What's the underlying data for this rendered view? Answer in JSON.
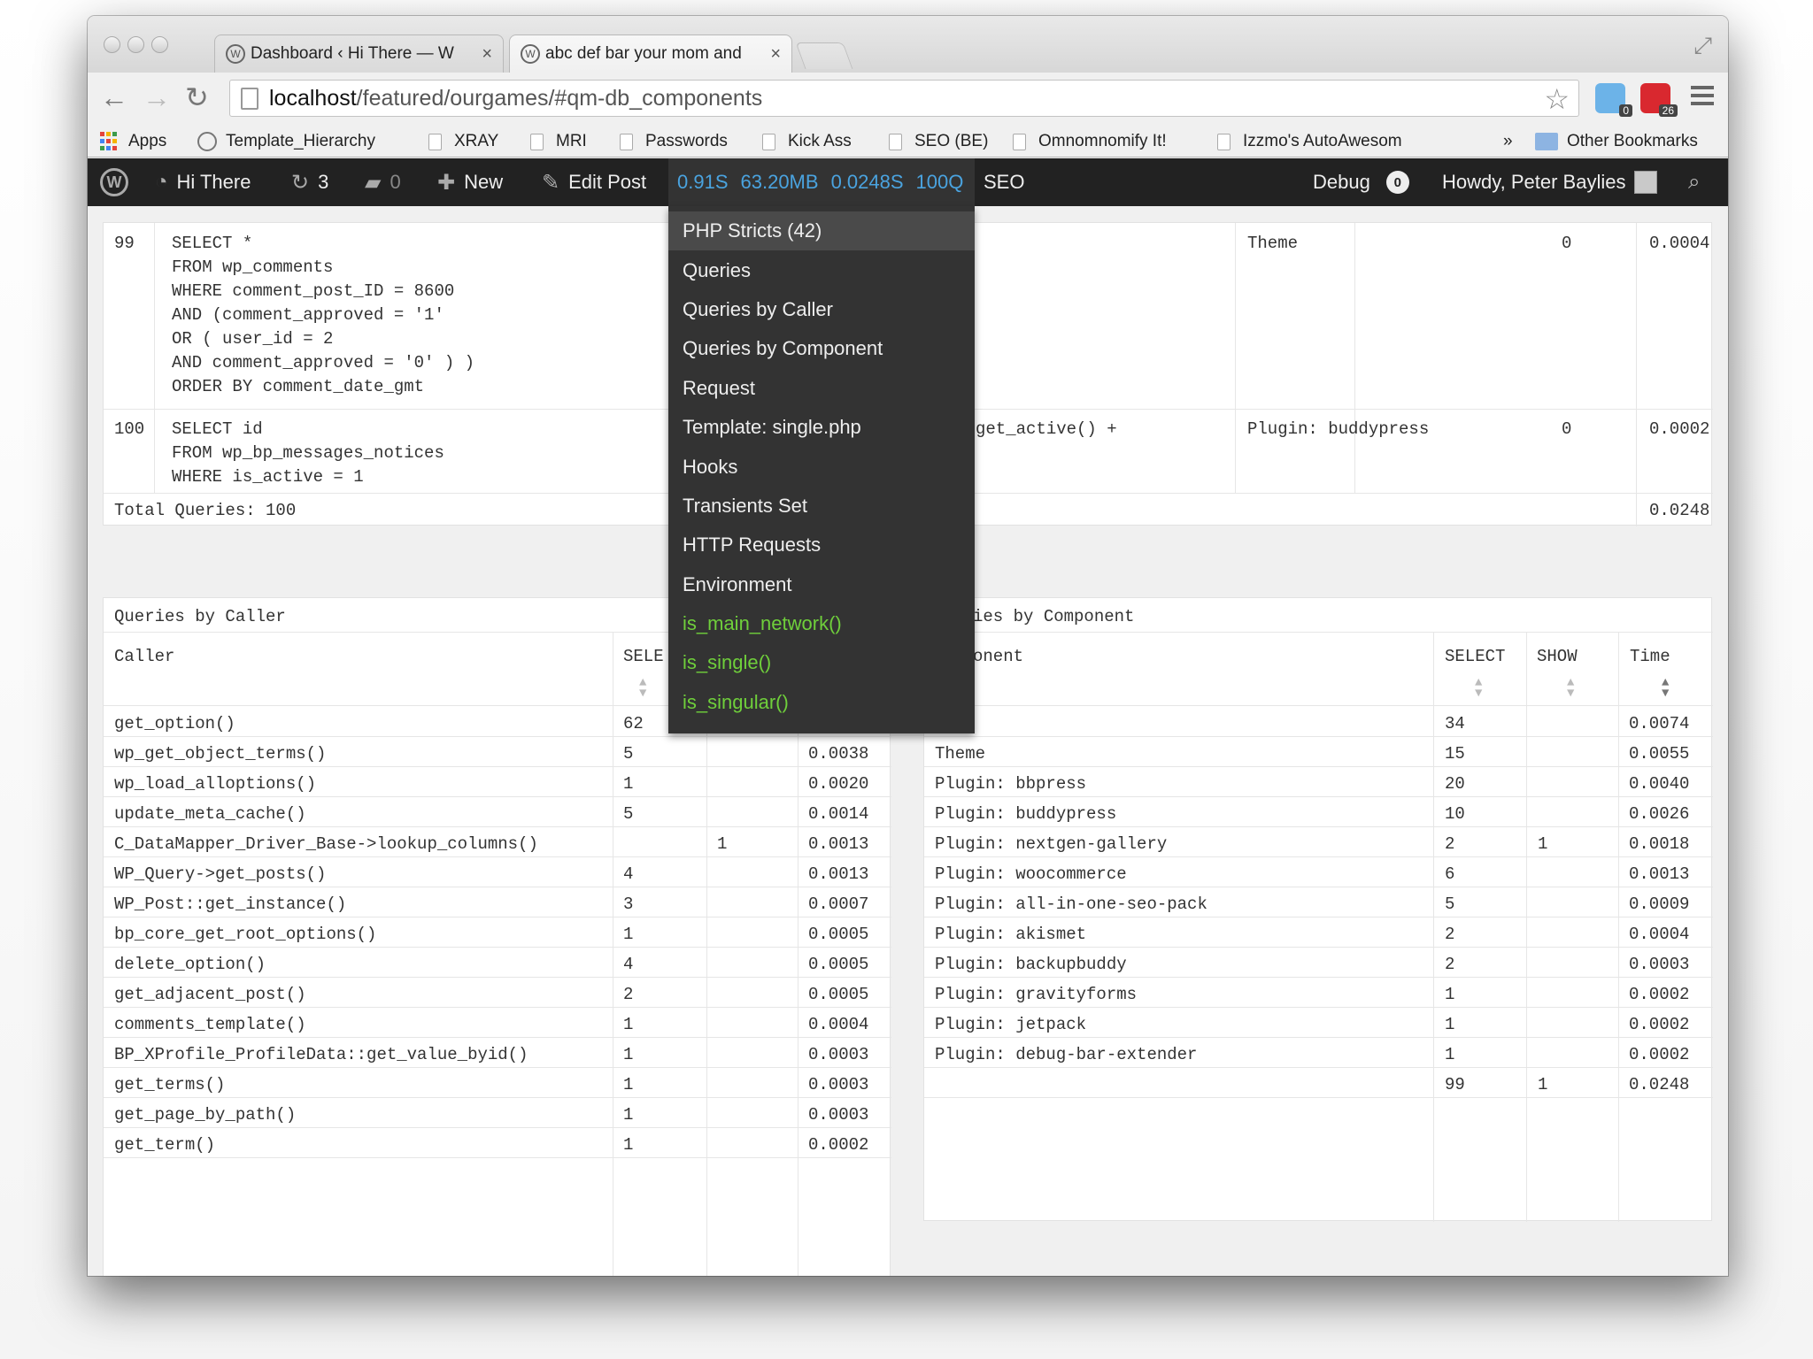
{
  "browser": {
    "tabs": [
      {
        "title": "Dashboard ‹ Hi There — W",
        "close": "×"
      },
      {
        "title": "abc def bar your mom and",
        "close": "×"
      }
    ],
    "url_host": "localhost",
    "url_path": "/featured/ourgames/#qm-db_components",
    "extensions": [
      {
        "badge": "0"
      },
      {
        "badge": "26"
      }
    ]
  },
  "bookmarks": {
    "items": [
      "Apps",
      "Template_Hierarchy",
      "XRAY",
      "MRI",
      "Passwords",
      "Kick Ass",
      "SEO (BE)",
      "Omnomnomify It!",
      "Izzmo's AutoAwesom"
    ],
    "overflow": "»",
    "other": "Other Bookmarks"
  },
  "adminbar": {
    "site": "Hi There",
    "updates": "3",
    "comments": "0",
    "new": "New",
    "edit": "Edit Post",
    "qm_time": "0.91S",
    "qm_mem": "63.20MB",
    "qm_dbtime": "0.0248S",
    "qm_queries": "100Q",
    "seo": "SEO",
    "debug": "Debug",
    "debug_count": "0",
    "howdy": "Howdy, Peter Baylies"
  },
  "qm_menu": {
    "items": [
      "PHP Stricts (42)",
      "Queries",
      "Queries by Caller",
      "Queries by Component",
      "Request",
      "Template: single.php",
      "Hooks",
      "Transients Set",
      "HTTP Requests",
      "Environment"
    ],
    "conditionals": [
      "is_main_network()",
      "is_single()",
      "is_singular()"
    ]
  },
  "queries": {
    "rows": [
      {
        "num": "99",
        "sql": [
          "SELECT *",
          "FROM wp_comments",
          "WHERE comment_post_ID = 8600",
          "AND (comment_approved = '1'",
          "OR ( user_id = 2",
          "AND comment_approved = '0' ) )",
          "ORDER BY comment_date_gmt"
        ],
        "caller": "",
        "component": "Theme",
        "rows": "0",
        "time": "0.0004"
      },
      {
        "num": "100",
        "sql": [
          "SELECT id",
          "FROM wp_bp_messages_notices",
          "WHERE is_active = 1"
        ],
        "caller": "get_active() +",
        "component": "Plugin: buddypress",
        "rows": "0",
        "time": "0.0002"
      }
    ],
    "total_label": "Total Queries: 100",
    "total_time": "0.0248"
  },
  "by_caller": {
    "title": "Queries by Caller",
    "headers": {
      "caller": "Caller",
      "select": "SELE"
    },
    "rows": [
      {
        "caller": "get_option()",
        "select": "62",
        "show": "",
        "time": ""
      },
      {
        "caller": "wp_get_object_terms()",
        "select": "5",
        "show": "",
        "time": "0.0038"
      },
      {
        "caller": "wp_load_alloptions()",
        "select": "1",
        "show": "",
        "time": "0.0020"
      },
      {
        "caller": "update_meta_cache()",
        "select": "5",
        "show": "",
        "time": "0.0014"
      },
      {
        "caller": "C_DataMapper_Driver_Base->lookup_columns()",
        "select": "",
        "show": "1",
        "time": "0.0013"
      },
      {
        "caller": "WP_Query->get_posts()",
        "select": "4",
        "show": "",
        "time": "0.0013"
      },
      {
        "caller": "WP_Post::get_instance()",
        "select": "3",
        "show": "",
        "time": "0.0007"
      },
      {
        "caller": "bp_core_get_root_options()",
        "select": "1",
        "show": "",
        "time": "0.0005"
      },
      {
        "caller": "delete_option()",
        "select": "4",
        "show": "",
        "time": "0.0005"
      },
      {
        "caller": "get_adjacent_post()",
        "select": "2",
        "show": "",
        "time": "0.0005"
      },
      {
        "caller": "comments_template()",
        "select": "1",
        "show": "",
        "time": "0.0004"
      },
      {
        "caller": "BP_XProfile_ProfileData::get_value_byid()",
        "select": "1",
        "show": "",
        "time": "0.0003"
      },
      {
        "caller": "get_terms()",
        "select": "1",
        "show": "",
        "time": "0.0003"
      },
      {
        "caller": "get_page_by_path()",
        "select": "1",
        "show": "",
        "time": "0.0003"
      },
      {
        "caller": "get_term()",
        "select": "1",
        "show": "",
        "time": "0.0002"
      }
    ]
  },
  "by_component": {
    "title": "ies by Component",
    "headers": {
      "component": "onent",
      "select": "SELECT",
      "show": "SHOW",
      "time": "Time"
    },
    "rows": [
      {
        "component": "",
        "select": "34",
        "show": "",
        "time": "0.0074"
      },
      {
        "component": "Theme",
        "select": "15",
        "show": "",
        "time": "0.0055"
      },
      {
        "component": "Plugin: bbpress",
        "select": "20",
        "show": "",
        "time": "0.0040"
      },
      {
        "component": "Plugin: buddypress",
        "select": "10",
        "show": "",
        "time": "0.0026"
      },
      {
        "component": "Plugin: nextgen-gallery",
        "select": "2",
        "show": "1",
        "time": "0.0018"
      },
      {
        "component": "Plugin: woocommerce",
        "select": "6",
        "show": "",
        "time": "0.0013"
      },
      {
        "component": "Plugin: all-in-one-seo-pack",
        "select": "5",
        "show": "",
        "time": "0.0009"
      },
      {
        "component": "Plugin: akismet",
        "select": "2",
        "show": "",
        "time": "0.0004"
      },
      {
        "component": "Plugin: backupbuddy",
        "select": "2",
        "show": "",
        "time": "0.0003"
      },
      {
        "component": "Plugin: gravityforms",
        "select": "1",
        "show": "",
        "time": "0.0002"
      },
      {
        "component": "Plugin: jetpack",
        "select": "1",
        "show": "",
        "time": "0.0002"
      },
      {
        "component": "Plugin: debug-bar-extender",
        "select": "1",
        "show": "",
        "time": "0.0002"
      },
      {
        "component": "",
        "select": "99",
        "show": "1",
        "time": "0.0248"
      }
    ]
  },
  "colors": {
    "adminbar": "#222222",
    "qm_accent": "#4aa3df",
    "conditional_green": "#6fcf3b",
    "menu_bg": "#333333"
  }
}
